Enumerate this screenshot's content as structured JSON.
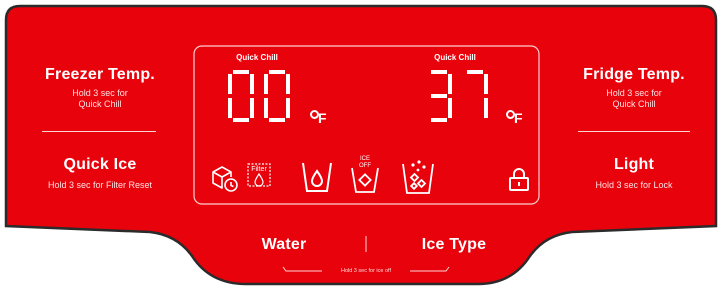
{
  "colors": {
    "panel": "#e8020c",
    "panel_outline": "#2b2b2b",
    "foreground": "#ffffff"
  },
  "left": {
    "freezer": {
      "title": "Freezer Temp.",
      "sub1": "Hold 3 sec for",
      "sub2": "Quick Chill"
    },
    "quick_ice": {
      "title": "Quick Ice",
      "sub": "Hold 3 sec for Filter Reset"
    }
  },
  "right": {
    "fridge": {
      "title": "Fridge Temp.",
      "sub1": "Hold 3 sec for",
      "sub2": "Quick Chill"
    },
    "light": {
      "title": "Light",
      "sub": "Hold 3 sec for Lock"
    }
  },
  "display": {
    "freezer": {
      "quick_chill": "Quick Chill",
      "value": "00",
      "unit": "F"
    },
    "fridge": {
      "quick_chill": "Quick Chill",
      "value": "37",
      "unit": "F"
    },
    "icons": [
      "ice-maker-clock-icon",
      "filter-reset-icon",
      "water-cup-icon",
      "ice-off-cup-icon",
      "crushed-ice-cup-icon",
      "lock-icon"
    ],
    "filter_label": "Filter",
    "ice_off_label_1": "ICE",
    "ice_off_label_2": "OFF"
  },
  "bottom": {
    "water": "Water",
    "ice_type": "Ice Type",
    "hint": "Hold 3 sec for ice off"
  }
}
